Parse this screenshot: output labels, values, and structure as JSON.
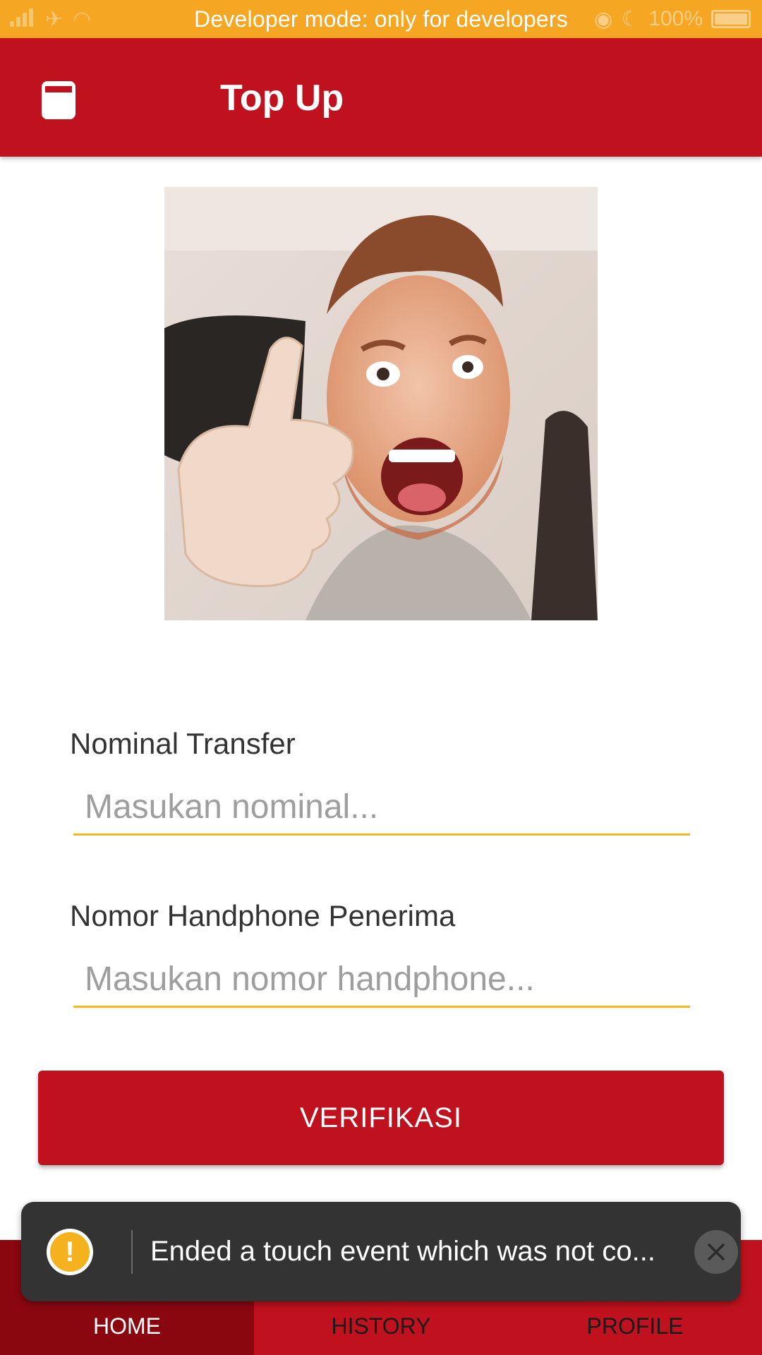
{
  "status_bar": {
    "text": "Developer mode: only for developers",
    "battery": "100%"
  },
  "app_bar": {
    "title": "Top Up",
    "icon": "wallet-icon"
  },
  "profile_photo": {
    "icon": "profile-photo"
  },
  "form": {
    "nominal_label": "Nominal Transfer",
    "nominal_placeholder": "Masukan nominal...",
    "nominal_value": "",
    "phone_label": "Nomor Handphone Penerima",
    "phone_placeholder": "Masukan nomor handphone...",
    "phone_value": "",
    "verify_label": "VERIFIKASI"
  },
  "bottom_nav": {
    "items": [
      {
        "label": "HOME",
        "active": true
      },
      {
        "label": "HISTORY",
        "active": false
      },
      {
        "label": "PROFILE",
        "active": false
      }
    ]
  },
  "toast": {
    "icon": "warning-icon",
    "message": "Ended a touch event which was not co..."
  },
  "colors": {
    "status_bar": "#f5a623",
    "primary": "#c0121e",
    "nav_active": "#8a0710",
    "underline": "#f5b820",
    "toast_bg": "#333333"
  }
}
